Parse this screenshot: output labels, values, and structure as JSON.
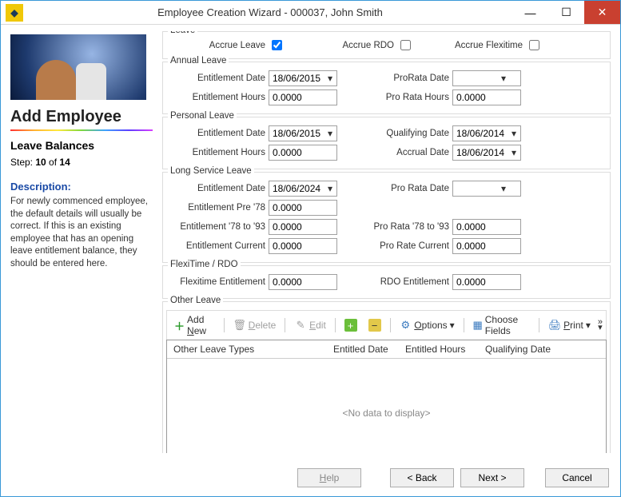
{
  "titlebar": {
    "title": "Employee Creation Wizard  - 000037, John Smith"
  },
  "left": {
    "heading": "Add Employee",
    "subtitle": "Leave Balances",
    "step_prefix": "Step: ",
    "step_cur": "10",
    "step_of": " of ",
    "step_total": "14",
    "desc_head": "Description:",
    "desc_body": "For newly commenced employee, the default details will usually be correct. If this is an existing employee that has an opening leave entitlement balance, they should be entered here."
  },
  "leave": {
    "group": "Leave",
    "accrue_leave": "Accrue Leave",
    "accrue_rdo": "Accrue RDO",
    "accrue_flexi": "Accrue Flexitime",
    "accrue_leave_checked": true,
    "accrue_rdo_checked": false,
    "accrue_flexi_checked": false
  },
  "annual": {
    "group": "Annual Leave",
    "ent_date_lbl": "Entitlement Date",
    "ent_date": "18/06/2015",
    "prorata_date_lbl": "ProRata Date",
    "prorata_date": "",
    "ent_hours_lbl": "Entitlement Hours",
    "ent_hours": "0.0000",
    "prorata_hours_lbl": "Pro Rata Hours",
    "prorata_hours": "0.0000"
  },
  "personal": {
    "group": "Personal Leave",
    "ent_date_lbl": "Entitlement Date",
    "ent_date": "18/06/2015",
    "qual_date_lbl": "Qualifying Date",
    "qual_date": "18/06/2014",
    "ent_hours_lbl": "Entitlement Hours",
    "ent_hours": "0.0000",
    "accr_date_lbl": "Accrual Date",
    "accr_date": "18/06/2014"
  },
  "lsl": {
    "group": "Long Service Leave",
    "ent_date_lbl": "Entitlement Date",
    "ent_date": "18/06/2024",
    "prorata_date_lbl": "Pro Rata Date",
    "prorata_date": "",
    "pre78_lbl": "Entitlement Pre '78",
    "pre78": "0.0000",
    "e78_93_lbl": "Entitlement '78 to '93",
    "e78_93": "0.0000",
    "pr78_93_lbl": "Pro Rata '78 to '93",
    "pr78_93": "0.0000",
    "cur_lbl": "Entitlement Current",
    "cur": "0.0000",
    "prcur_lbl": "Pro Rate Current",
    "prcur": "0.0000"
  },
  "flexi": {
    "group": "FlexiTime / RDO",
    "flexi_lbl": "Flexitime Entitlement",
    "flexi": "0.0000",
    "rdo_lbl": "RDO Entitlement",
    "rdo": "0.0000"
  },
  "other": {
    "group": "Other Leave",
    "add_new": "Add New",
    "delete": "Delete",
    "edit": "Edit",
    "options": "Options",
    "choose_fields": "Choose Fields",
    "print": "Print",
    "col_types": "Other Leave Types",
    "col_entitled_date": "Entitled Date",
    "col_entitled_hours": "Entitled Hours",
    "col_qual_date": "Qualifying Date",
    "no_data": "<No data to display>"
  },
  "footer": {
    "help": "Help",
    "back": "< Back",
    "next": "Next >",
    "cancel": "Cancel"
  }
}
